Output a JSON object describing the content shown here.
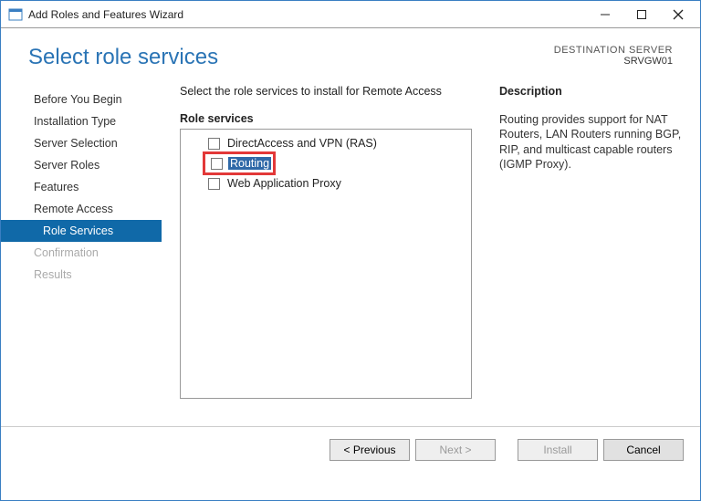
{
  "title": "Add Roles and Features Wizard",
  "page_title": "Select role services",
  "destination": {
    "label": "DESTINATION SERVER",
    "name": "SRVGW01"
  },
  "sidebar": {
    "items": [
      {
        "label": "Before You Begin"
      },
      {
        "label": "Installation Type"
      },
      {
        "label": "Server Selection"
      },
      {
        "label": "Server Roles"
      },
      {
        "label": "Features"
      },
      {
        "label": "Remote Access"
      },
      {
        "label": "Role Services"
      },
      {
        "label": "Confirmation"
      },
      {
        "label": "Results"
      }
    ]
  },
  "main": {
    "instruction": "Select the role services to install for Remote Access",
    "role_label": "Role services",
    "roles": {
      "directaccess": "DirectAccess and VPN (RAS)",
      "routing": "Routing",
      "webproxy": "Web Application Proxy"
    },
    "desc_label": "Description",
    "desc_text": "Routing provides support for NAT Routers, LAN Routers running BGP, RIP, and multicast capable routers (IGMP Proxy)."
  },
  "footer": {
    "previous": "< Previous",
    "next": "Next >",
    "install": "Install",
    "cancel": "Cancel"
  }
}
